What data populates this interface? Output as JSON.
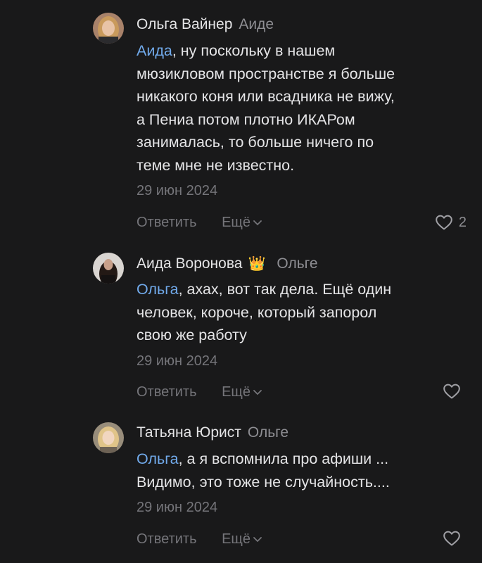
{
  "comments": [
    {
      "author": "Ольга Вайнер",
      "reply_to": "Аиде",
      "mention": "Аида",
      "text_lines": [
        ", ну поскольку в нашем",
        "мюзикловом пространстве я больше",
        "никакого коня или всадника не вижу,",
        "а Пениа потом плотно ИКАРом",
        "занималась, то больше ничего по",
        "теме мне не известно."
      ],
      "date": "29 июн 2024",
      "reply_label": "Ответить",
      "more_label": "Ещё",
      "likes": "2",
      "avatar_colors": {
        "bg": "#b98a6a",
        "hair": "#c89a5a",
        "face": "#e6c2a6"
      }
    },
    {
      "author": "Аида Воронова",
      "crown": "👑",
      "reply_to": "Ольге",
      "mention": "Ольга",
      "text_lines": [
        ", ахах, вот так дела. Ещё один",
        "человек, короче, который запорол",
        "свою же работу"
      ],
      "date": "29 июн 2024",
      "reply_label": "Ответить",
      "more_label": "Ещё",
      "likes": "",
      "avatar_colors": {
        "bg": "#d8d4d0",
        "hair": "#2a1e1a",
        "face": "#c9a08a"
      }
    },
    {
      "author": "Татьяна Юрист",
      "reply_to": "Ольге",
      "mention": "Ольга",
      "text_lines": [
        ", а я вспомнила про афиши ...",
        "Видимо, это тоже не случайность...."
      ],
      "date": "29 июн 2024",
      "reply_label": "Ответить",
      "more_label": "Ещё",
      "likes": "",
      "avatar_colors": {
        "bg": "#9a8f7d",
        "hair": "#e2c78a",
        "face": "#f0d4bd"
      }
    }
  ],
  "icons": {
    "like": "heart-outline-icon",
    "more": "chevron-down-icon"
  }
}
